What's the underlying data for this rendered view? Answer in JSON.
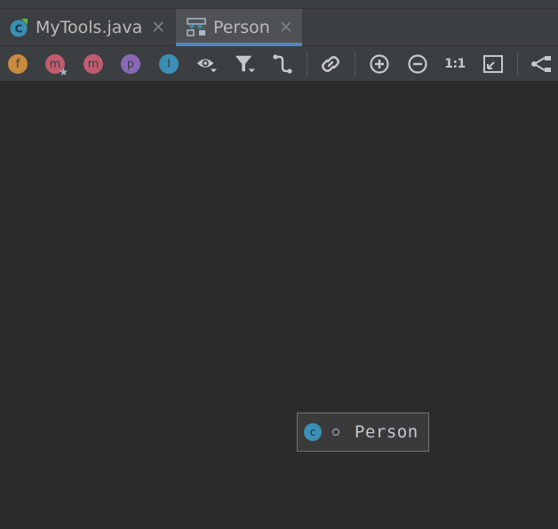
{
  "tabs": [
    {
      "label": "MyTools.java",
      "icon": "java-class-icon",
      "active": false
    },
    {
      "label": "Person",
      "icon": "uml-diagram-icon",
      "active": true
    }
  ],
  "toolbar": {
    "items": [
      {
        "name": "fields-toggle",
        "glyph": "f",
        "color": "#c78a3f"
      },
      {
        "name": "constructors-toggle",
        "glyph": "m",
        "color": "#c05c6f"
      },
      {
        "name": "methods-toggle",
        "glyph": "m",
        "color": "#c05c6f"
      },
      {
        "name": "properties-toggle",
        "glyph": "p",
        "color": "#8a68b8"
      },
      {
        "name": "inner-classes-toggle",
        "glyph": "I",
        "color": "#3b8fb4"
      }
    ],
    "zoom_actual_label": "1:1"
  },
  "diagram": {
    "node": {
      "label": "Person",
      "kind_glyph": "c",
      "kind_color": "#3b8fb4"
    }
  },
  "colors": {
    "background": "#2b2b2b",
    "panel": "#3c3f41",
    "active_tab": "#4e5254",
    "accent": "#4a88c7"
  }
}
